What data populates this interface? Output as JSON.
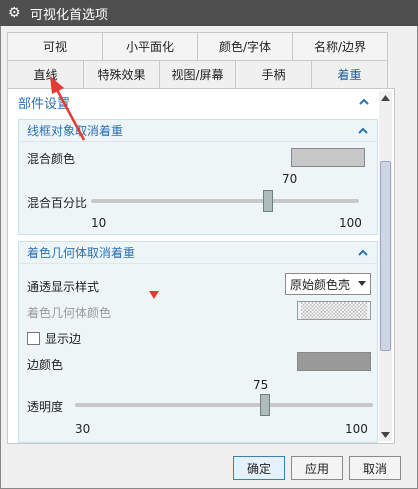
{
  "window": {
    "title": "可视化首选项"
  },
  "tabs": {
    "row1": [
      "可视",
      "小平面化",
      "颜色/字体",
      "名称/边界"
    ],
    "row2": [
      "直线",
      "特殊效果",
      "视图/屏幕",
      "手柄",
      "着重"
    ],
    "active": "着重"
  },
  "section": {
    "title": "部件设置"
  },
  "group1": {
    "title": "线框对象取消着重",
    "mix_color_label": "混合颜色",
    "mix_percent_label": "混合百分比",
    "slider": {
      "value": 70,
      "min": 10,
      "max": 100,
      "value_label": "70",
      "min_label": "10",
      "max_label": "100"
    },
    "swatch_color": "#c8c8c8"
  },
  "group2": {
    "title": "着色几何体取消着重",
    "transparency_style_label": "通透显示样式",
    "transparency_style_value": "原始颜色壳",
    "geometry_color_label": "着色几何体颜色",
    "show_edges_label": "显示边",
    "edge_color_label": "边颜色",
    "edge_swatch_color": "#999999",
    "transparency_label": "透明度",
    "slider": {
      "value": 75,
      "min": 30,
      "max": 100,
      "value_label": "75",
      "min_label": "30",
      "max_label": "100"
    }
  },
  "footer": {
    "ok": "确定",
    "apply": "应用",
    "cancel": "取消"
  },
  "colors": {
    "accent": "#2b71b5",
    "titlebar": "#4f4f4f",
    "annotation": "#e53935"
  }
}
